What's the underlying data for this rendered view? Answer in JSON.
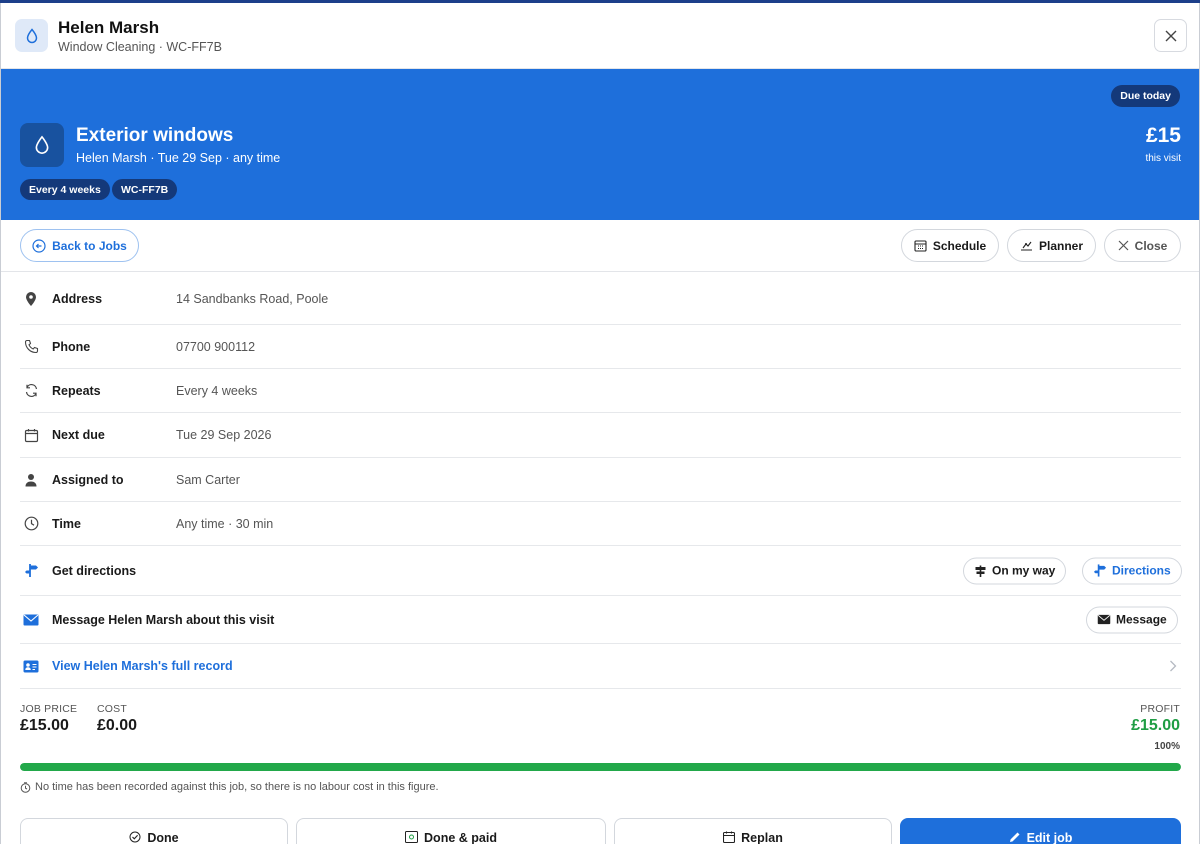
{
  "header": {
    "title": "Helen Marsh",
    "subtitle": "Window Cleaning · WC-FF7B"
  },
  "hero": {
    "badge": "Due today",
    "title": "Exterior windows",
    "subtitle": "Helen Marsh · Tue 29 Sep · any time",
    "price": "£15",
    "price_sub": "this visit",
    "tags": [
      "Every 4 weeks",
      "WC-FF7B"
    ]
  },
  "actions": {
    "back": "Back to Jobs",
    "schedule": "Schedule",
    "planner": "Planner",
    "close": "Close"
  },
  "details": [
    {
      "label": "Address",
      "value": "14 Sandbanks Road, Poole",
      "icon": "map-pin-icon"
    },
    {
      "label": "Phone",
      "value": "07700 900112",
      "icon": "phone-icon"
    },
    {
      "label": "Repeats",
      "value": "Every 4 weeks",
      "icon": "repeat-icon"
    },
    {
      "label": "Next due",
      "value": "Tue 29 Sep 2026",
      "icon": "calendar-icon"
    },
    {
      "label": "Assigned to",
      "value": "Sam Carter",
      "icon": "person-icon"
    },
    {
      "label": "Time",
      "value": "Any time · 30 min",
      "icon": "clock-icon"
    }
  ],
  "directions": {
    "label": "Get directions",
    "on_my_way": "On my way",
    "directions": "Directions"
  },
  "message": {
    "label": "Message Helen Marsh about this visit",
    "button": "Message"
  },
  "record": {
    "label": "View Helen Marsh's full record"
  },
  "financials": {
    "job_price_label": "JOB PRICE",
    "job_price": "£15.00",
    "cost_label": "COST",
    "cost": "£0.00",
    "profit_label": "PROFIT",
    "profit": "£15.00",
    "profit_pct_label": "100%",
    "profit_fraction": 1.0,
    "note": "No time has been recorded against this job, so there is no labour cost in this figure."
  },
  "footer": {
    "done": "Done",
    "done_paid": "Done & paid",
    "replan": "Replan",
    "edit": "Edit job"
  },
  "colors": {
    "accent": "#1e6fdb",
    "profit": "#1f9d44",
    "progress": "#22a84a"
  }
}
